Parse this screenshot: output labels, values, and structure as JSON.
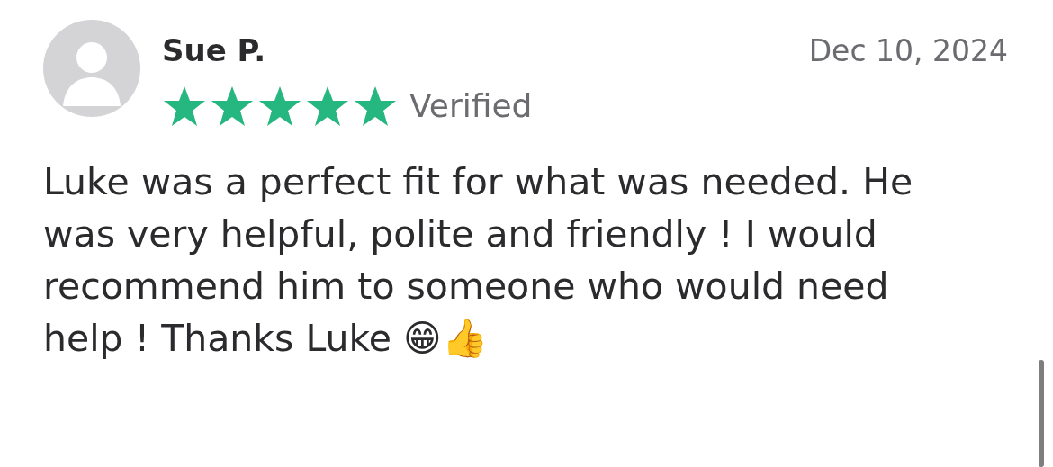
{
  "review": {
    "author": "Sue P.",
    "date": "Dec 10, 2024",
    "stars": 5,
    "badge": "Verified",
    "text": "Luke was a perfect fit for what was needed. He was very helpful, polite and friendly ! I would recommend him to someone who would need help ! Thanks Luke 😁👍"
  }
}
